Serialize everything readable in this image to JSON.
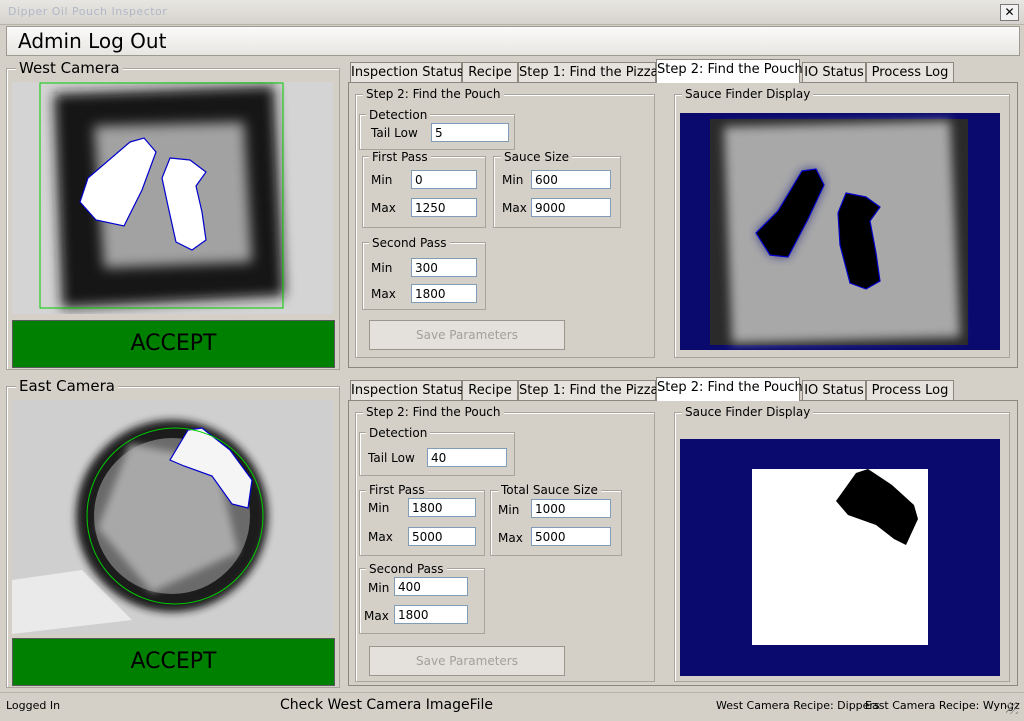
{
  "window": {
    "title": "Dipper Oil Pouch Inspector",
    "close_label": "✕"
  },
  "menu": {
    "admin_label": "Admin Log Out"
  },
  "west": {
    "title": "West Camera",
    "result": "ACCEPT",
    "tabs": [
      "Inspection Status",
      "Recipe",
      "Step 1: Find the Pizza",
      "Step 2: Find the Pouch",
      "IO Status",
      "Process Log"
    ],
    "active_tab": "Step 2: Find the Pouch",
    "step_title": "Step 2: Find the Pouch",
    "detection": {
      "title": "Detection",
      "tail_low_label": "Tail Low",
      "tail_low": "5"
    },
    "first_pass": {
      "title": "First Pass",
      "min_label": "Min",
      "min": "0",
      "max_label": "Max",
      "max": "1250"
    },
    "sauce": {
      "title": "Sauce Size",
      "min_label": "Min",
      "min": "600",
      "max_label": "Max",
      "max": "9000"
    },
    "second_pass": {
      "title": "Second Pass",
      "min_label": "Min",
      "min": "300",
      "max_label": "Max",
      "max": "1800"
    },
    "save_label": "Save Parameters",
    "display_title": "Sauce Finder Display"
  },
  "east": {
    "title": "East Camera",
    "result": "ACCEPT",
    "tabs": [
      "Inspection Status",
      "Recipe",
      "Step 1: Find the Pizza",
      "Step 2: Find the Pouch",
      "IO Status",
      "Process Log"
    ],
    "active_tab": "Step 2: Find the Pouch",
    "step_title": "Step 2: Find the Pouch",
    "detection": {
      "title": "Detection",
      "tail_low_label": "Tail Low",
      "tail_low": "40"
    },
    "first_pass": {
      "title": "First Pass",
      "min_label": "Min",
      "min": "1800",
      "max_label": "Max",
      "max": "5000"
    },
    "sauce": {
      "title": "Total Sauce Size",
      "min_label": "Min",
      "min": "1000",
      "max_label": "Max",
      "max": "5000"
    },
    "second_pass": {
      "title": "Second Pass",
      "min_label": "Min",
      "min": "400",
      "max_label": "Max",
      "max": "1800"
    },
    "save_label": "Save Parameters",
    "display_title": "Sauce Finder Display"
  },
  "status": {
    "login": "Logged In",
    "message": "Check West Camera ImageFile",
    "west_recipe": "West Camera Recipe: Dippers",
    "east_recipe": "East Camera Recipe: Wyngz"
  },
  "colors": {
    "accept": "#008000",
    "display_bg": "#0a0a6e",
    "outline": "#0000cc",
    "roi": "#00cc00"
  }
}
